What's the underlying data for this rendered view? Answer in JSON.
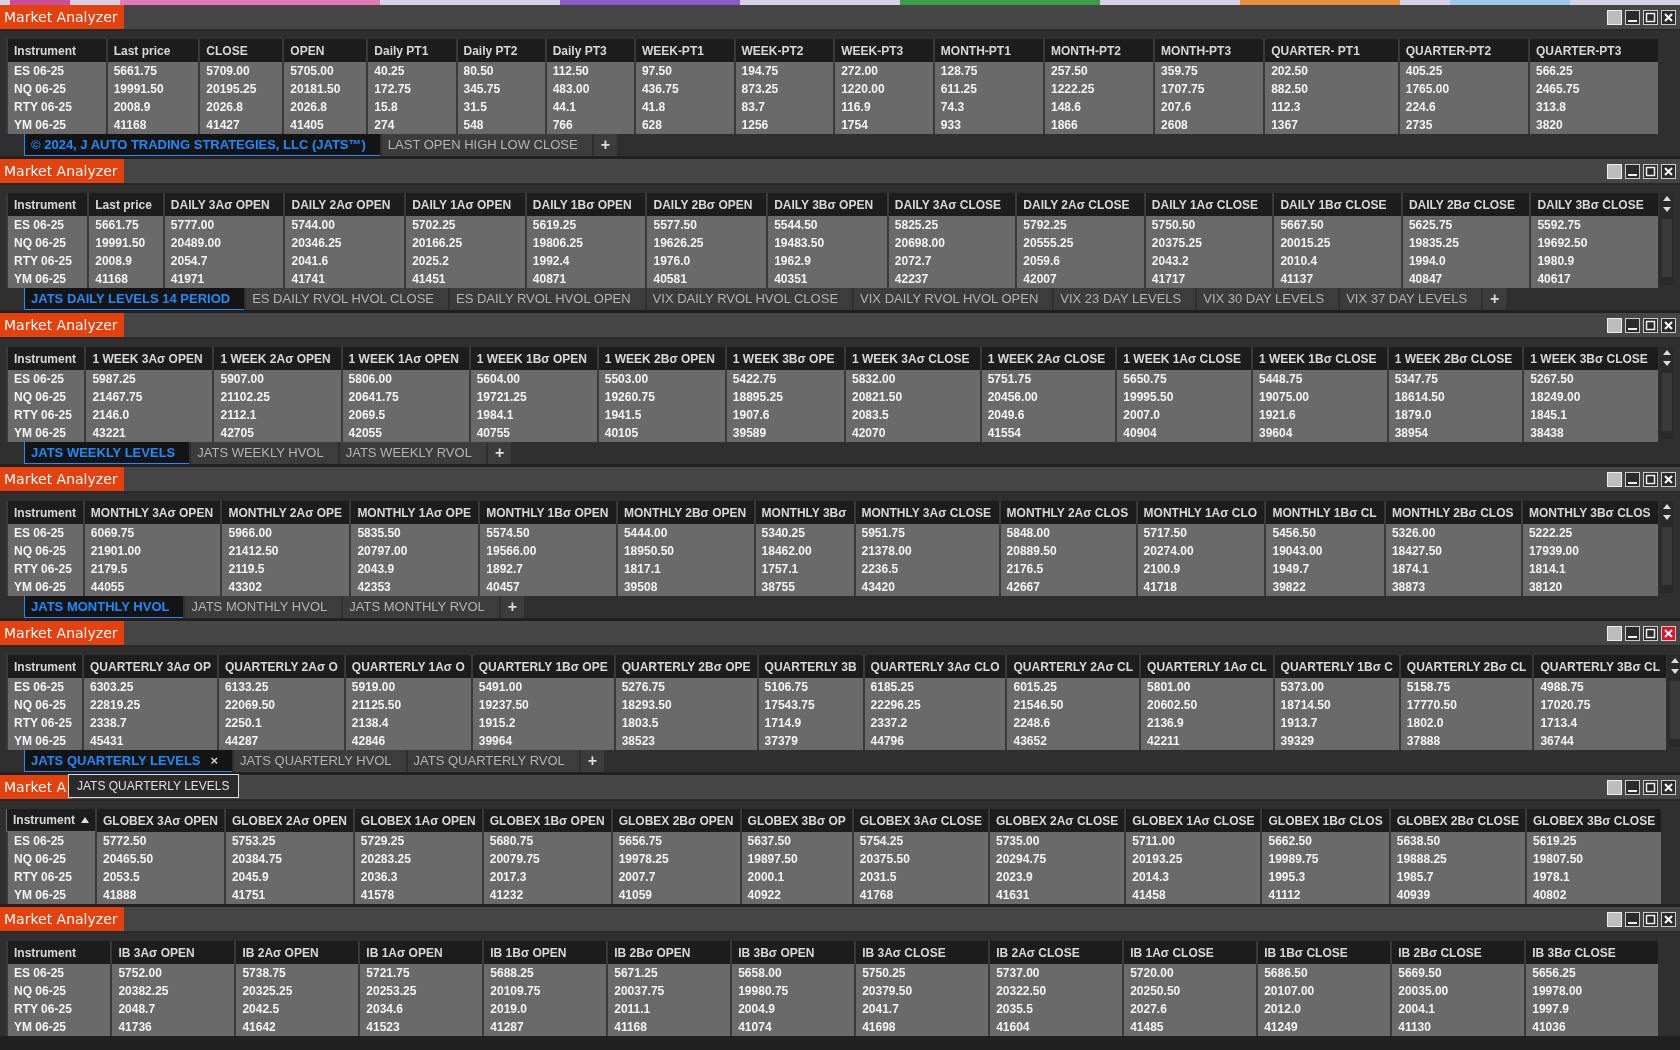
{
  "windows": [
    {
      "title": "Market Analyzer",
      "close_active": false,
      "scrollbar": false,
      "columns": [
        "Instrument",
        "Last price",
        "CLOSE",
        "OPEN",
        "Daily PT1",
        "Daily PT2",
        "Daily PT3",
        "WEEK-PT1",
        "WEEK-PT2",
        "WEEK-PT3",
        "MONTH-PT1",
        "MONTH-PT2",
        "MONTH-PT3",
        "QUARTER- PT1",
        "QUARTER-PT2",
        "QUARTER-PT3"
      ],
      "rows": [
        [
          "ES 06-25",
          "5661.75",
          "5709.00",
          "5705.00",
          "40.25",
          "80.50",
          "112.50",
          "97.50",
          "194.75",
          "272.00",
          "128.75",
          "257.50",
          "359.75",
          "202.50",
          "405.25",
          "566.25"
        ],
        [
          "NQ 06-25",
          "19991.50",
          "20195.25",
          "20181.50",
          "172.75",
          "345.75",
          "483.00",
          "436.75",
          "873.25",
          "1220.00",
          "611.25",
          "1222.25",
          "1707.75",
          "882.50",
          "1765.00",
          "2465.75"
        ],
        [
          "RTY 06-25",
          "2008.9",
          "2026.8",
          "2026.8",
          "15.8",
          "31.5",
          "44.1",
          "41.8",
          "83.7",
          "116.9",
          "74.3",
          "148.6",
          "207.6",
          "112.3",
          "224.6",
          "313.8"
        ],
        [
          "YM 06-25",
          "41168",
          "41427",
          "41405",
          "274",
          "548",
          "766",
          "628",
          "1256",
          "1754",
          "933",
          "1866",
          "2608",
          "1367",
          "2735",
          "3820"
        ]
      ],
      "tabs": [
        {
          "label": "© 2024, J AUTO TRADING STRATEGIES, LLC (JATS™)",
          "selected": true
        },
        {
          "label": "LAST OPEN HIGH LOW CLOSE",
          "selected": false
        }
      ],
      "add_tab": "+"
    },
    {
      "title": "Market Analyzer",
      "close_active": false,
      "scrollbar": true,
      "columns": [
        "Instrument",
        "Last price",
        "DAILY 3Aσ OPEN",
        "DAILY 2Aσ OPEN",
        "DAILY 1Aσ OPEN",
        "DAILY 1Bσ OPEN",
        "DAILY 2Bσ OPEN",
        "DAILY 3Bσ OPEN",
        "DAILY 3Aσ CLOSE",
        "DAILY 2Aσ CLOSE",
        "DAILY 1Aσ CLOSE",
        "DAILY 1Bσ CLOSE",
        "DAILY 2Bσ CLOSE",
        "DAILY 3Bσ CLOSE"
      ],
      "rows": [
        [
          "ES 06-25",
          "5661.75",
          "5777.00",
          "5744.00",
          "5702.25",
          "5619.25",
          "5577.50",
          "5544.50",
          "5825.25",
          "5792.25",
          "5750.50",
          "5667.50",
          "5625.75",
          "5592.75"
        ],
        [
          "NQ 06-25",
          "19991.50",
          "20489.00",
          "20346.25",
          "20166.25",
          "19806.25",
          "19626.25",
          "19483.50",
          "20698.00",
          "20555.25",
          "20375.25",
          "20015.25",
          "19835.25",
          "19692.50"
        ],
        [
          "RTY 06-25",
          "2008.9",
          "2054.7",
          "2041.6",
          "2025.2",
          "1992.4",
          "1976.0",
          "1962.9",
          "2072.7",
          "2059.6",
          "2043.2",
          "2010.4",
          "1994.0",
          "1980.9"
        ],
        [
          "YM 06-25",
          "41168",
          "41971",
          "41741",
          "41451",
          "40871",
          "40581",
          "40351",
          "42237",
          "42007",
          "41717",
          "41137",
          "40847",
          "40617"
        ]
      ],
      "tabs": [
        {
          "label": "JATS DAILY LEVELS 14 PERIOD",
          "selected": true
        },
        {
          "label": "ES DAILY RVOL HVOL CLOSE",
          "selected": false
        },
        {
          "label": "ES DAILY RVOL HVOL OPEN",
          "selected": false
        },
        {
          "label": "VIX DAILY RVOL HVOL CLOSE",
          "selected": false
        },
        {
          "label": "VIX DAILY RVOL HVOL OPEN",
          "selected": false
        },
        {
          "label": "VIX 23 DAY LEVELS",
          "selected": false
        },
        {
          "label": "VIX 30 DAY LEVELS",
          "selected": false
        },
        {
          "label": "VIX 37 DAY LEVELS",
          "selected": false
        }
      ],
      "add_tab": "+"
    },
    {
      "title": "Market Analyzer",
      "close_active": false,
      "scrollbar": true,
      "columns": [
        "Instrument",
        "1 WEEK 3Aσ OPEN",
        "1 WEEK 2Aσ OPEN",
        "1 WEEK 1Aσ OPEN",
        "1 WEEK 1Bσ OPEN",
        "1 WEEK 2Bσ OPEN",
        "1 WEEK 3Bσ OPE",
        "1 WEEK 3Aσ CLOSE",
        "1 WEEK 2Aσ CLOSE",
        "1 WEEK 1Aσ CLOSE",
        "1 WEEK 1Bσ CLOSE",
        "1 WEEK 2Bσ CLOSE",
        "1 WEEK 3Bσ CLOSE"
      ],
      "rows": [
        [
          "ES 06-25",
          "5987.25",
          "5907.00",
          "5806.00",
          "5604.00",
          "5503.00",
          "5422.75",
          "5832.00",
          "5751.75",
          "5650.75",
          "5448.75",
          "5347.75",
          "5267.50"
        ],
        [
          "NQ 06-25",
          "21467.75",
          "21102.25",
          "20641.75",
          "19721.25",
          "19260.75",
          "18895.25",
          "20821.50",
          "20456.00",
          "19995.50",
          "19075.00",
          "18614.50",
          "18249.00"
        ],
        [
          "RTY 06-25",
          "2146.0",
          "2112.1",
          "2069.5",
          "1984.1",
          "1941.5",
          "1907.6",
          "2083.5",
          "2049.6",
          "2007.0",
          "1921.6",
          "1879.0",
          "1845.1"
        ],
        [
          "YM 06-25",
          "43221",
          "42705",
          "42055",
          "40755",
          "40105",
          "39589",
          "42070",
          "41554",
          "40904",
          "39604",
          "38954",
          "38438"
        ]
      ],
      "tabs": [
        {
          "label": "JATS WEEKLY LEVELS",
          "selected": true
        },
        {
          "label": "JATS WEEKLY HVOL",
          "selected": false
        },
        {
          "label": "JATS WEEKLY RVOL",
          "selected": false
        }
      ],
      "add_tab": "+"
    },
    {
      "title": "Market Analyzer",
      "close_active": false,
      "scrollbar": true,
      "columns": [
        "Instrument",
        "MONTHLY 3Aσ OPEN",
        "MONTHLY 2Aσ OPE",
        "MONTHLY 1Aσ OPE",
        "MONTHLY 1Bσ OPEN",
        "MONTHLY 2Bσ OPEN",
        "MONTHLY 3Bσ",
        "MONTHLY 3Aσ CLOSE",
        "MONTHLY 2Aσ CLOS",
        "MONTHLY 1Aσ CLO",
        "MONTHLY 1Bσ CL",
        "MONTHLY 2Bσ CLOS",
        "MONTHLY 3Bσ CLOS"
      ],
      "rows": [
        [
          "ES 06-25",
          "6069.75",
          "5966.00",
          "5835.50",
          "5574.50",
          "5444.00",
          "5340.25",
          "5951.75",
          "5848.00",
          "5717.50",
          "5456.50",
          "5326.00",
          "5222.25"
        ],
        [
          "NQ 06-25",
          "21901.00",
          "21412.50",
          "20797.00",
          "19566.00",
          "18950.50",
          "18462.00",
          "21378.00",
          "20889.50",
          "20274.00",
          "19043.00",
          "18427.50",
          "17939.00"
        ],
        [
          "RTY 06-25",
          "2179.5",
          "2119.5",
          "2043.9",
          "1892.7",
          "1817.1",
          "1757.1",
          "2236.5",
          "2176.5",
          "2100.9",
          "1949.7",
          "1874.1",
          "1814.1"
        ],
        [
          "YM 06-25",
          "44055",
          "43302",
          "42353",
          "40457",
          "39508",
          "38755",
          "43420",
          "42667",
          "41718",
          "39822",
          "38873",
          "38120"
        ]
      ],
      "tabs": [
        {
          "label": "JATS MONTHLY HVOL",
          "selected": true
        },
        {
          "label": "JATS MONTHLY HVOL",
          "selected": false
        },
        {
          "label": "JATS MONTHLY RVOL",
          "selected": false
        }
      ],
      "add_tab": "+"
    },
    {
      "title": "Market Analyzer",
      "close_active": true,
      "scrollbar": true,
      "columns": [
        "Instrument",
        "QUARTERLY 3Aσ OP",
        "QUARTERLY 2Aσ O",
        "QUARTERLY 1Aσ O",
        "QUARTERLY 1Bσ OPE",
        "QUARTERLY 2Bσ OPE",
        "QUARTERLY 3B",
        "QUARTERLY 3Aσ CLO",
        "QUARTERLY 2Aσ CL",
        "QUARTERLY 1Aσ CL",
        "QUARTERLY 1Bσ C",
        "QUARTERLY 2Bσ CL",
        "QUARTERLY 3Bσ CL"
      ],
      "rows": [
        [
          "ES 06-25",
          "6303.25",
          "6133.25",
          "5919.00",
          "5491.00",
          "5276.75",
          "5106.75",
          "6185.25",
          "6015.25",
          "5801.00",
          "5373.00",
          "5158.75",
          "4988.75"
        ],
        [
          "NQ 06-25",
          "22819.25",
          "22069.50",
          "21125.50",
          "19237.50",
          "18293.50",
          "17543.75",
          "22296.25",
          "21546.50",
          "20602.50",
          "18714.50",
          "17770.50",
          "17020.75"
        ],
        [
          "RTY 06-25",
          "2338.7",
          "2250.1",
          "2138.4",
          "1915.2",
          "1803.5",
          "1714.9",
          "2337.2",
          "2248.6",
          "2136.9",
          "1913.7",
          "1802.0",
          "1713.4"
        ],
        [
          "YM 06-25",
          "45431",
          "44287",
          "42846",
          "39964",
          "38523",
          "37379",
          "44796",
          "43652",
          "42211",
          "39329",
          "37888",
          "36744"
        ]
      ],
      "tabs": [
        {
          "label": "JATS QUARTERLY LEVELS",
          "selected": true,
          "close": "×"
        },
        {
          "label": "JATS QUARTERLY HVOL",
          "selected": false
        },
        {
          "label": "JATS QUARTERLY RVOL",
          "selected": false
        }
      ],
      "add_tab": "+",
      "tooltip": "JATS QUARTERLY LEVELS"
    },
    {
      "title": "Market A",
      "close_active": false,
      "scrollbar": false,
      "columns": [
        {
          "label": "Instrument",
          "sort_ascending": true
        },
        "GLOBEX 3Aσ OPEN",
        "GLOBEX 2Aσ OPEN",
        "GLOBEX 1Aσ OPEN",
        "GLOBEX 1Bσ OPEN",
        "GLOBEX 2Bσ OPEN",
        "GLOBEX 3Bσ OP",
        "GLOBEX 3Aσ CLOSE",
        "GLOBEX 2Aσ CLOSE",
        "GLOBEX 1Aσ CLOSE",
        "GLOBEX 1Bσ CLOS",
        "GLOBEX 2Bσ CLOSE",
        "GLOBEX 3Bσ CLOSE"
      ],
      "rows": [
        [
          "ES 06-25",
          "5772.50",
          "5753.25",
          "5729.25",
          "5680.75",
          "5656.75",
          "5637.50",
          "5754.25",
          "5735.00",
          "5711.00",
          "5662.50",
          "5638.50",
          "5619.25"
        ],
        [
          "NQ 06-25",
          "20465.50",
          "20384.75",
          "20283.25",
          "20079.75",
          "19978.25",
          "19897.50",
          "20375.50",
          "20294.75",
          "20193.25",
          "19989.75",
          "19888.25",
          "19807.50"
        ],
        [
          "RTY 06-25",
          "2053.5",
          "2045.9",
          "2036.3",
          "2017.3",
          "2007.7",
          "2000.1",
          "2031.5",
          "2023.9",
          "2014.3",
          "1995.3",
          "1985.7",
          "1978.1"
        ],
        [
          "YM 06-25",
          "41888",
          "41751",
          "41578",
          "41232",
          "41059",
          "40922",
          "41768",
          "41631",
          "41458",
          "41112",
          "40939",
          "40802"
        ]
      ]
    },
    {
      "title": "Market Analyzer",
      "close_active": false,
      "scrollbar": false,
      "columns": [
        "Instrument",
        "IB 3Aσ OPEN",
        "IB 2Aσ OPEN",
        "IB 1Aσ OPEN",
        "IB 1Bσ OPEN",
        "IB 2Bσ OPEN",
        "IB 3Bσ OPEN",
        "IB 3Aσ CLOSE",
        "IB 2Aσ CLOSE",
        "IB 1Aσ CLOSE",
        "IB 1Bσ CLOSE",
        "IB 2Bσ CLOSE",
        "IB 3Bσ CLOSE"
      ],
      "rows": [
        [
          "ES 06-25",
          "5752.00",
          "5738.75",
          "5721.75",
          "5688.25",
          "5671.25",
          "5658.00",
          "5750.25",
          "5737.00",
          "5720.00",
          "5686.50",
          "5669.50",
          "5656.25"
        ],
        [
          "NQ 06-25",
          "20382.25",
          "20325.25",
          "20253.25",
          "20109.75",
          "20037.75",
          "19980.75",
          "20379.50",
          "20322.50",
          "20250.50",
          "20107.00",
          "20035.00",
          "19978.00"
        ],
        [
          "RTY 06-25",
          "2048.7",
          "2042.5",
          "2034.6",
          "2019.0",
          "2011.1",
          "2004.9",
          "2041.7",
          "2035.5",
          "2027.6",
          "2012.0",
          "2004.1",
          "1997.9"
        ],
        [
          "YM 06-25",
          "41736",
          "41642",
          "41523",
          "41287",
          "41168",
          "41074",
          "41698",
          "41604",
          "41485",
          "41249",
          "41130",
          "41036"
        ]
      ]
    }
  ]
}
